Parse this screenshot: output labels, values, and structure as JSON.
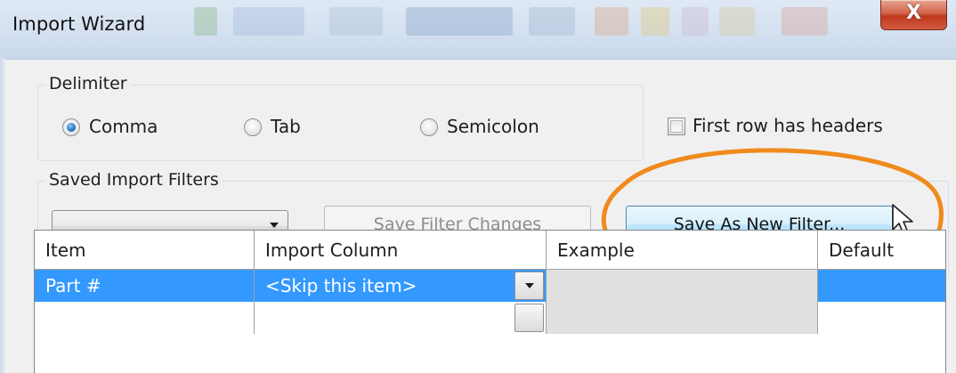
{
  "window": {
    "title": "Import Wizard",
    "close_glyph": "X",
    "accent_colors": {
      "titlebar": "#d6e2f1",
      "close": "#c0391d",
      "selection": "#3399ff",
      "highlight_ring": "#f08a1c"
    }
  },
  "delimiter": {
    "group_label": "Delimiter",
    "options": [
      {
        "label": "Comma",
        "selected": true
      },
      {
        "label": "Tab",
        "selected": false
      },
      {
        "label": "Semicolon",
        "selected": false
      }
    ],
    "headers_checkbox": {
      "label": "First row has headers",
      "checked": false
    }
  },
  "filters": {
    "group_label": "Saved Import Filters",
    "selected_filter": "",
    "save_changes_label": "Save Filter Changes",
    "save_new_label": "Save As New Filter..."
  },
  "grid": {
    "columns": [
      "Item",
      "Import Column",
      "Example",
      "Default"
    ],
    "rows": [
      {
        "item": "Part #",
        "import_column": "<Skip this item>",
        "example": "",
        "default": "",
        "selected": true
      }
    ]
  },
  "icons": {
    "close": "close-icon",
    "radio": "radio-button",
    "checkbox": "checkbox",
    "dropdown": "chevron-down-icon",
    "cursor": "mouse-pointer-icon"
  }
}
